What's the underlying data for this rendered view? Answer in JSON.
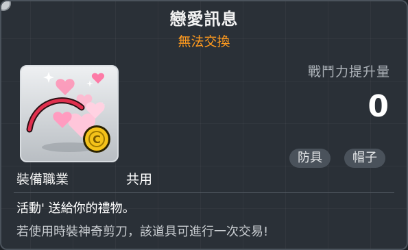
{
  "item": {
    "name": "戀愛訊息",
    "trade_status": "無法交換",
    "trade_status_color": "#ff9a1e"
  },
  "icon": {
    "semantic": "heart-whip-coin-icon",
    "coin_symbol": "C"
  },
  "combat_power": {
    "label": "戰鬥力提升量",
    "value": "0"
  },
  "tags": [
    {
      "label": "防具"
    },
    {
      "label": "帽子"
    }
  ],
  "job": {
    "label": "裝備職業",
    "value": "共用"
  },
  "description": {
    "line1": "活動' 送給你的禮物。",
    "line2": "若使用時裝神奇剪刀，該道具可進行一次交易!"
  }
}
